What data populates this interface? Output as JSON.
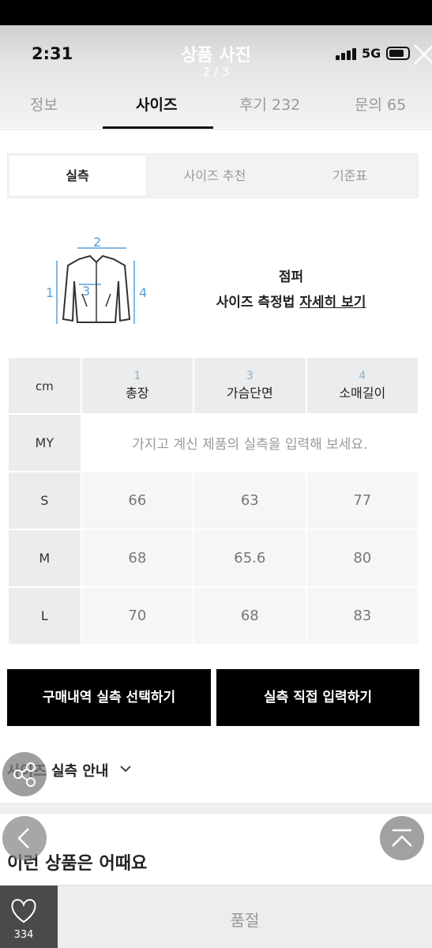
{
  "status": {
    "time": "2:31",
    "network": "5G"
  },
  "viewer": {
    "title": "상품 사진",
    "count": "2 / 3"
  },
  "tabs": [
    {
      "label": "정보"
    },
    {
      "label": "사이즈"
    },
    {
      "label": "후기 232"
    },
    {
      "label": "문의 65"
    }
  ],
  "size_tabs": [
    {
      "label": "실측"
    },
    {
      "label": "사이즈 추천"
    },
    {
      "label": "기준표"
    }
  ],
  "fit": {
    "title": "점퍼",
    "guide_prefix": "사이즈 측정법 ",
    "guide_link": "자세히 보기",
    "diagram_labels": [
      "1",
      "2",
      "3",
      "4"
    ]
  },
  "size_table": {
    "unit": "cm",
    "columns": [
      {
        "num": "1",
        "name": "총장"
      },
      {
        "num": "3",
        "name": "가슴단면"
      },
      {
        "num": "4",
        "name": "소매길이"
      }
    ],
    "my_label": "MY",
    "my_placeholder": "가지고 계신 제품의 실측을 입력해 보세요.",
    "rows": [
      {
        "size": "S",
        "values": [
          "66",
          "63",
          "77"
        ]
      },
      {
        "size": "M",
        "values": [
          "68",
          "65.6",
          "80"
        ]
      },
      {
        "size": "L",
        "values": [
          "70",
          "68",
          "83"
        ]
      }
    ]
  },
  "buttons": {
    "purchase_select": "구매내역 실측 선택하기",
    "direct_input": "실측 직접 입력하기"
  },
  "guide_label": "사이즈 실측 안내",
  "recommend_title": "이런 상품은 어때요",
  "bottom": {
    "like_count": "334",
    "soldout": "품절"
  },
  "colors": {
    "primary": "#000000",
    "accent_number": "#7fb3d9"
  }
}
